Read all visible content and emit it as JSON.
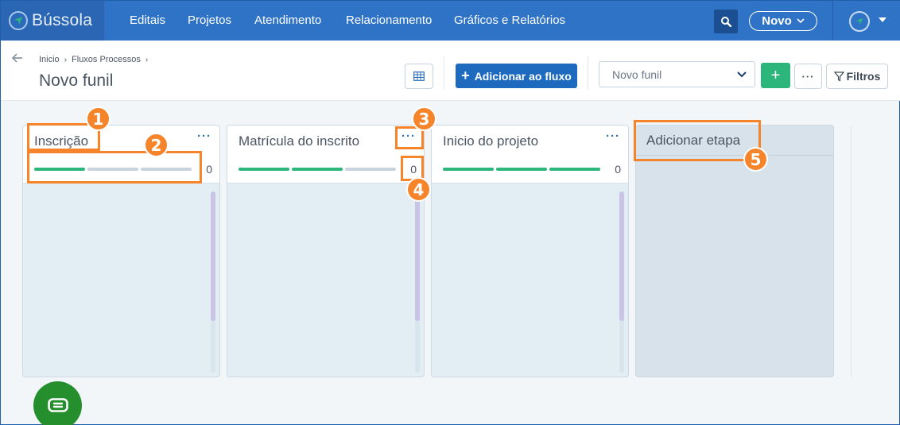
{
  "nav": {
    "brand": "Bússola",
    "links": [
      "Editais",
      "Projetos",
      "Atendimento",
      "Relacionamento",
      "Gráficos e Relatórios"
    ],
    "new_button": "Novo"
  },
  "header": {
    "breadcrumb": [
      "Inicio",
      "Fluxos Processos"
    ],
    "title": "Novo funil",
    "add_to_flow": "Adicionar ao fluxo",
    "funnel_select": "Novo funil",
    "filters": "Filtros"
  },
  "columns": [
    {
      "title": "Inscrição",
      "count": "0",
      "progress_filled": 1,
      "progress_total": 3
    },
    {
      "title": "Matrícula do inscrito",
      "count": "0",
      "progress_filled": 2,
      "progress_total": 3
    },
    {
      "title": "Inicio do projeto",
      "count": "0",
      "progress_filled": 3,
      "progress_total": 3
    }
  ],
  "add_stage": "Adicionar etapa",
  "annotations": [
    "1",
    "2",
    "3",
    "4",
    "5"
  ],
  "colors": {
    "nav_bg": "#2f73c6",
    "primary": "#1d6abf",
    "success": "#2db67c",
    "annotation": "#f5842a",
    "chat": "#258f2d"
  }
}
